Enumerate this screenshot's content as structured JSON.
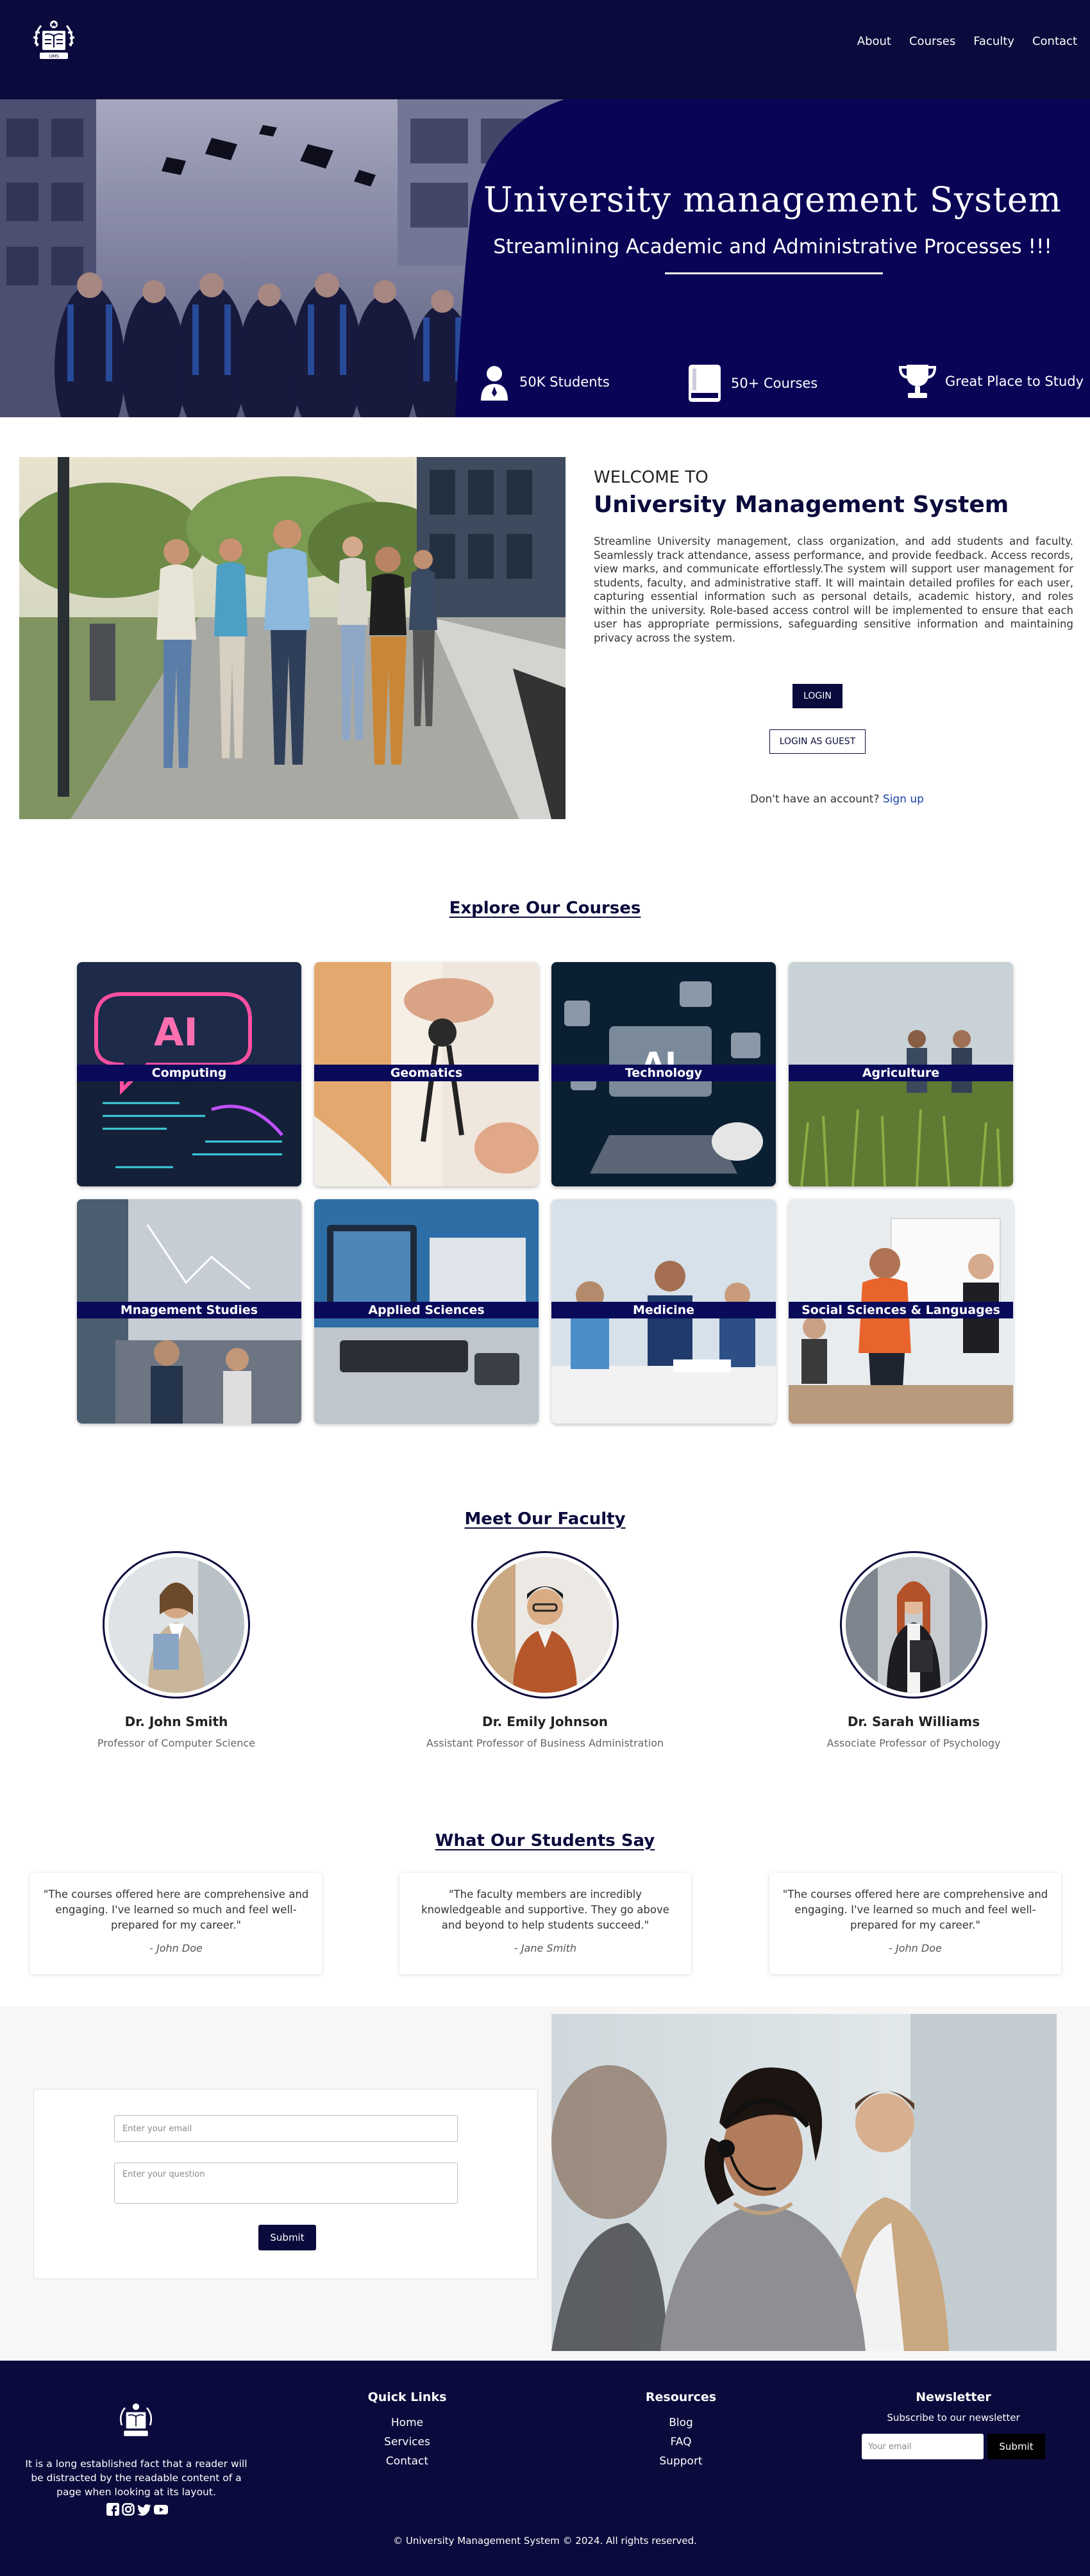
{
  "header": {
    "logo_icon": "university-crest-icon",
    "nav": [
      "About",
      "Courses",
      "Faculty",
      "Contact"
    ]
  },
  "hero": {
    "title": "University management System",
    "subtitle": "Streamlining Academic and Administrative Processes !!!",
    "stats": [
      {
        "icon": "student-icon",
        "label": "50K Students"
      },
      {
        "icon": "book-icon",
        "label": "50+ Courses"
      },
      {
        "icon": "trophy-icon",
        "label": "Great Place to Study"
      }
    ]
  },
  "welcome": {
    "kicker": "WELCOME TO",
    "title": "University Management System",
    "text": "Streamline University management, class organization, and add students and faculty. Seamlessly track attendance, assess performance, and provide feedback. Access records, view marks, and communicate effortlessly.The system will support user management for students, faculty, and administrative staff. It will maintain detailed profiles for each user, capturing essential information such as personal details, academic history, and roles within the university. Role-based access control will be implemented to ensure that each user has appropriate permissions, safeguarding sensitive information and maintaining privacy across the system.",
    "login_label": "LOGIN",
    "guest_label": "LOGIN AS GUEST",
    "signup_prompt": "Don't have an account?",
    "signup_link": "Sign up"
  },
  "courses": {
    "heading": "Explore Our Courses",
    "items": [
      "Computing",
      "Geomatics",
      "Technology",
      "Agriculture",
      "Mnagement Studies",
      "Applied Sciences",
      "Medicine",
      "Social Sciences & Languages"
    ]
  },
  "faculty": {
    "heading": "Meet Our Faculty",
    "members": [
      {
        "name": "Dr. John Smith",
        "role": "Professor of Computer Science"
      },
      {
        "name": "Dr. Emily Johnson",
        "role": "Assistant Professor of Business Administration"
      },
      {
        "name": "Dr. Sarah Williams",
        "role": "Associate Professor of Psychology"
      }
    ]
  },
  "testimonials": {
    "heading": "What Our Students Say",
    "items": [
      {
        "quote": "\"The courses offered here are comprehensive and engaging. I've learned so much and feel well-prepared for my career.\"",
        "author": "- John Doe"
      },
      {
        "quote": "\"The faculty members are incredibly knowledgeable and supportive. They go above and beyond to help students succeed.\"",
        "author": "- Jane Smith"
      },
      {
        "quote": "\"The courses offered here are comprehensive and engaging. I've learned so much and feel well-prepared for my career.\"",
        "author": "- John Doe"
      }
    ]
  },
  "contact": {
    "email_placeholder": "Enter your email",
    "question_placeholder": "Enter your question",
    "submit_label": "Submit"
  },
  "footer": {
    "about": "It is a long established fact that a reader will be distracted by the readable content of a page when looking at its layout.",
    "social_icons": [
      "facebook-icon",
      "instagram-icon",
      "twitter-icon",
      "youtube-icon"
    ],
    "quick_links": {
      "title": "Quick Links",
      "links": [
        "Home",
        "Services",
        "Contact"
      ]
    },
    "resources": {
      "title": "Resources",
      "links": [
        "Blog",
        "FAQ",
        "Support"
      ]
    },
    "newsletter": {
      "title": "Newsletter",
      "subtitle": "Subscribe to our newsletter",
      "placeholder": "Your email",
      "button": "Submit"
    },
    "copyright": "© University Management System © 2024. All rights reserved."
  },
  "colors": {
    "navy": "#0a0a3c",
    "hero_blue": "#0a0456",
    "link_blue": "#1a3fa8"
  }
}
